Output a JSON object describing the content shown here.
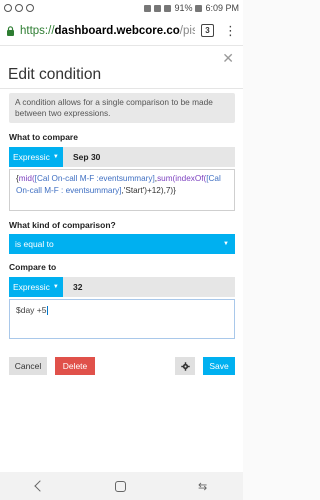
{
  "status_bar": {
    "battery": "91%",
    "time": "6:09 PM"
  },
  "browser": {
    "url_scheme": "https://",
    "url_host": "dashboard.webcore.co",
    "url_path": "/pisto",
    "tab_count": "3"
  },
  "dialog": {
    "title": "Edit condition",
    "info": "A condition allows for a single comparison to be made between two expressions.",
    "what_to_compare_label": "What to compare",
    "left_operand": {
      "type_label": "Expressic",
      "evaluated_value": "Sep 30",
      "expression_parts": [
        "{",
        "mid(",
        "[Cal On-call M-F :eventsummary]",
        ",",
        "sum(",
        "indexOf(",
        "[Cal On-call M-F : eventsummary]",
        ",",
        "'Start'",
        ")+12),7)}"
      ]
    },
    "comparison_label": "What kind of comparison?",
    "comparison_value": "is equal to",
    "compare_to_label": "Compare to",
    "right_operand": {
      "type_label": "Expressic",
      "evaluated_value": "32",
      "expression": "$day +5"
    },
    "buttons": {
      "cancel": "Cancel",
      "delete": "Delete",
      "save": "Save"
    }
  },
  "colors": {
    "accent": "#00b0f0",
    "danger": "#e0514a",
    "function": "#7b3fbf",
    "string": "#3f6fc2"
  }
}
